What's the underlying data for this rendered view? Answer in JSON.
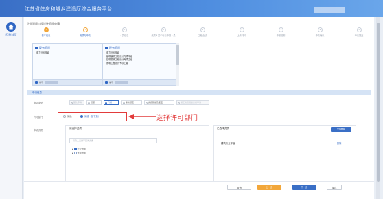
{
  "app": {
    "title": "江苏省住房和城乡建设厅综合服务平台"
  },
  "nav": {
    "home_label": "回到首页"
  },
  "form": {
    "title": "企业资质工程设计资质申请"
  },
  "steps": [
    {
      "num": "1",
      "label": "基本信息",
      "state": "done"
    },
    {
      "num": "2",
      "label": "资质与申请",
      "state": "current"
    },
    {
      "num": "3",
      "label": "人员信息",
      "state": "todo"
    },
    {
      "num": "4",
      "label": "资质人员中标与申报人员",
      "state": "todo"
    },
    {
      "num": "5",
      "label": "工程业绩",
      "state": "todo"
    },
    {
      "num": "6",
      "label": "上传材料",
      "state": "todo"
    },
    {
      "num": "7",
      "label": "申报说明",
      "state": "todo"
    },
    {
      "num": "8",
      "label": "申请确认",
      "state": "todo"
    },
    {
      "num": "9",
      "label": "申请提交",
      "state": "todo"
    }
  ],
  "cards": [
    {
      "title": "现有资质",
      "lines": [
        "电力行业甲级"
      ],
      "footer_label": "编号"
    },
    {
      "title": "现有资质",
      "lines": [
        "电力行业甲级",
        "建筑装饰工程设计专项甲级",
        "建筑幕墙工程设计专项乙级",
        "照明工程设计专项乙级"
      ],
      "footer_label": "编号"
    }
  ],
  "apply_section": {
    "title": "申请信息"
  },
  "apply_type": {
    "label": "申请类型",
    "options": [
      {
        "text": "首次申请",
        "state": "disabled"
      },
      {
        "text": "增项",
        "state": "normal"
      },
      {
        "text": "升级",
        "state": "selected"
      },
      {
        "text": "重新核定",
        "state": "normal"
      },
      {
        "text": "资质延续及变更",
        "state": "normal"
      },
      {
        "text": "施工资质延续升级申请",
        "state": "disabled"
      }
    ]
  },
  "permit_dept": {
    "label": "许可部门",
    "options": [
      {
        "text": "省级",
        "selected": false
      },
      {
        "text": "省级（部下放）",
        "selected": true
      }
    ]
  },
  "annotation": {
    "text": "选择许可部门",
    "color": "#e23b3b"
  },
  "qual_select": {
    "label": "申请资质",
    "left_title": "请选择资质",
    "search_placeholder": "请输入关键字查询资质",
    "tree": [
      {
        "text": "行业资质",
        "checked": true
      },
      {
        "text": "专项资质",
        "checked": false
      }
    ],
    "right_title": "已选择资质",
    "clear_label": "全部删除",
    "selected": [
      {
        "text": "建筑行业甲级",
        "action": "删除"
      }
    ]
  },
  "buttons": {
    "cancel": "取消",
    "prev": "上一步",
    "next": "下一步",
    "save": "保存"
  },
  "colors": {
    "primary": "#3a6fc6",
    "accent": "#f2a73b",
    "annotation": "#e23b3b"
  }
}
